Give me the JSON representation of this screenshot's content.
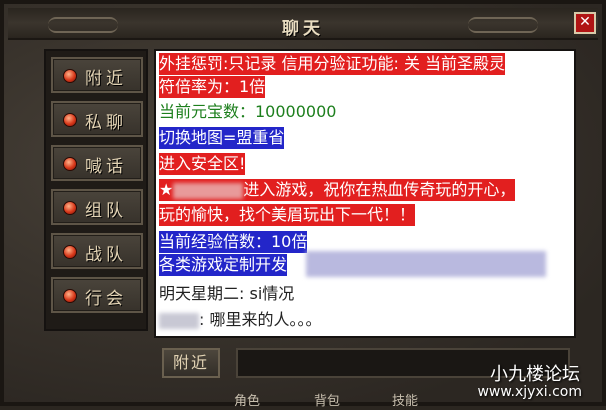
{
  "window": {
    "title": "聊天",
    "close_label": "✕"
  },
  "sidebar": {
    "items": [
      {
        "label": "附近"
      },
      {
        "label": "私聊"
      },
      {
        "label": "喊话"
      },
      {
        "label": "组队"
      },
      {
        "label": "战队"
      },
      {
        "label": "行会"
      }
    ]
  },
  "chat": {
    "lines": [
      {
        "text": "外挂惩罚:只记录 信用分验证功能: 关 当前圣殿灵"
      },
      {
        "text": "符倍率为：1倍"
      },
      {
        "text": "当前元宝数：10000000"
      },
      {
        "text": "切换地图=盟重省"
      },
      {
        "text": "进入安全区!"
      },
      {
        "text": "★",
        "text2": "进入游戏，祝你在热血传奇玩的开心，"
      },
      {
        "text": "玩的愉快，找个美眉玩出下一代！！"
      },
      {
        "text": "当前经验倍数：10倍"
      },
      {
        "text": "各类游戏定制开发"
      },
      {
        "text": "明天星期二: si情况"
      },
      {
        "text": ": 哪里来的人。。。"
      }
    ]
  },
  "bottom": {
    "nearby_label": "附近",
    "input_value": ""
  },
  "game_strip": {
    "item1": "角色",
    "item2": "背包",
    "item3": "技能"
  },
  "watermark": {
    "line1": "小九楼论坛",
    "line2": "www.xjyxi.com"
  },
  "colors": {
    "red_bg": "#e21f1f",
    "blue_bg": "#2326c9",
    "green_text": "#1d7f1d"
  }
}
